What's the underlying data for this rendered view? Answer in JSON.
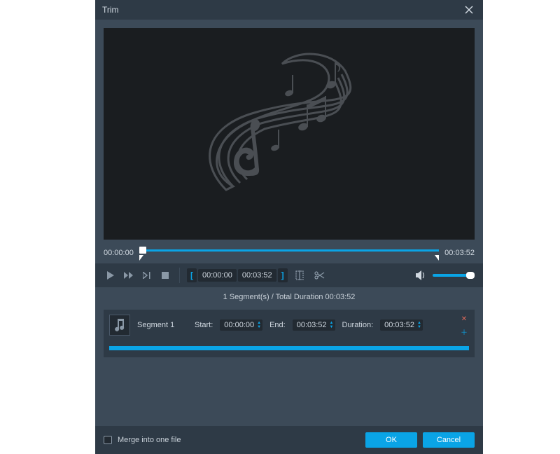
{
  "window": {
    "title": "Trim"
  },
  "timeline": {
    "start": "00:00:00",
    "end": "00:03:52"
  },
  "edit": {
    "in": "00:00:00",
    "out": "00:03:52"
  },
  "summary": "1 Segment(s) / Total Duration 00:03:52",
  "segment": {
    "name": "Segment 1",
    "start_label": "Start:",
    "start": "00:00:00",
    "end_label": "End:",
    "end": "00:03:52",
    "duration_label": "Duration:",
    "duration": "00:03:52"
  },
  "footer": {
    "merge_label": "Merge into one file",
    "ok": "OK",
    "cancel": "Cancel"
  }
}
